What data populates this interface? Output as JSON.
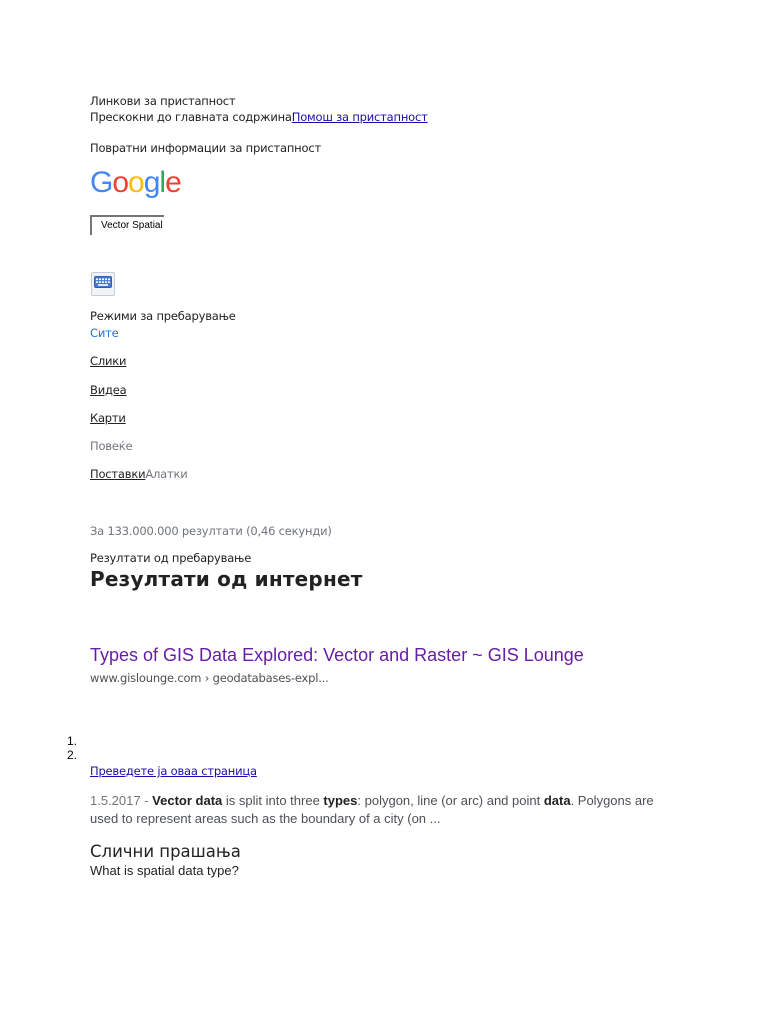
{
  "accessibility": {
    "heading": "Линкови за пристапност",
    "skip_link": "Прескокни до главната содржина",
    "help_link": "Помош за пристапност",
    "feedback": "Повратни информации за пристапност"
  },
  "logo": {
    "letters": [
      {
        "char": "G",
        "color": "#4285f4"
      },
      {
        "char": "o",
        "color": "#ea4335"
      },
      {
        "char": "o",
        "color": "#fbbc05"
      },
      {
        "char": "g",
        "color": "#4285f4"
      },
      {
        "char": "l",
        "color": "#34a853"
      },
      {
        "char": "e",
        "color": "#ea4335"
      }
    ]
  },
  "search": {
    "value": "Vector Spatial"
  },
  "keyboard_icon": "keyboard-icon",
  "modes": {
    "label": "Режими за пребарување",
    "all": "Сите",
    "images": "Слики",
    "videos": "Видеа",
    "maps": "Карти",
    "more": "Повеќе",
    "settings": "Поставки",
    "tools": "Алатки"
  },
  "stats": "За 133.000.000 резултати (0,46 секунди)",
  "results_label": "Резултати од пребарување",
  "web_results_heading": "Резултати од интернет",
  "result": {
    "title": "Types of GIS Data Explored: Vector and Raster ~ GIS Lounge",
    "url": "www.gislounge.com › geodatabases-expl...",
    "list_markers": [
      "1.",
      "2."
    ],
    "translate_link": "Преведете ја оваа страница",
    "snippet_date": "1.5.2017",
    "snippet_sep": " - ",
    "snippet_parts": [
      {
        "text": "Vector data",
        "bold": true
      },
      {
        "text": " is split into three ",
        "bold": false
      },
      {
        "text": "types",
        "bold": true
      },
      {
        "text": ": polygon, line (or arc) and point ",
        "bold": false
      },
      {
        "text": "data",
        "bold": true
      },
      {
        "text": ". Polygons are used to represent areas such as the boundary of a city (on ...",
        "bold": false
      }
    ]
  },
  "related": {
    "heading": "Слични прашања",
    "first_question": "What is spatial data type?"
  },
  "colors": {
    "link_blue": "#1a0dab",
    "visited_purple": "#681da8",
    "active_mode_blue": "#1a73e8",
    "gray_text": "#70757a"
  }
}
